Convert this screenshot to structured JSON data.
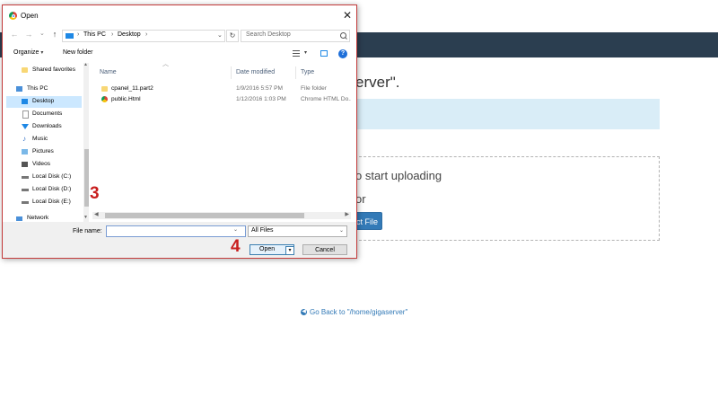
{
  "web_page": {
    "heading_fragment": "erver\".",
    "drop_text": "o start uploading",
    "or_text": "or",
    "select_file_btn": "ct File",
    "go_back_link": "Go Back to \"/home/gigaserver\""
  },
  "dialog": {
    "title": "Open",
    "close_glyph": "✕",
    "nav": {
      "back_glyph": "←",
      "forward_glyph": "→",
      "recent_glyph": "⌄",
      "up_glyph": "↑",
      "breadcrumbs": [
        "This PC",
        "Desktop"
      ],
      "separator": "›",
      "refresh_glyph": "↻",
      "search_placeholder": "Search Desktop"
    },
    "toolbar": {
      "organize_label": "Organize",
      "new_folder_label": "New folder",
      "help_glyph": "?"
    },
    "left_nav": {
      "items": [
        {
          "label": "Shared favorites",
          "icon": "folder-icon"
        },
        {
          "label": "This PC",
          "icon": "pc-icon"
        },
        {
          "label": "Desktop",
          "icon": "desktop-icon",
          "selected": true
        },
        {
          "label": "Documents",
          "icon": "documents-icon"
        },
        {
          "label": "Downloads",
          "icon": "download-icon"
        },
        {
          "label": "Music",
          "icon": "music-icon"
        },
        {
          "label": "Pictures",
          "icon": "pictures-icon"
        },
        {
          "label": "Videos",
          "icon": "videos-icon"
        },
        {
          "label": "Local Disk (C:)",
          "icon": "disk-icon"
        },
        {
          "label": "Local Disk (D:)",
          "icon": "disk-icon"
        },
        {
          "label": "Local Disk (E:)",
          "icon": "disk-icon"
        },
        {
          "label": "Network",
          "icon": "network-icon"
        }
      ]
    },
    "file_list": {
      "columns": [
        "Name",
        "Date modified",
        "Type"
      ],
      "rows": [
        {
          "name": "cpanel_11.part2",
          "date": "1/9/2016 5:57 PM",
          "type": "File folder",
          "icon": "folder-icon"
        },
        {
          "name": "public.Html",
          "date": "1/12/2016 1:03 PM",
          "type": "Chrome HTML Do...",
          "icon": "chrome-icon"
        }
      ]
    },
    "bottom": {
      "file_name_label": "File name:",
      "file_name_value": "",
      "filter_value": "All Files",
      "open_label": "Open",
      "cancel_label": "Cancel"
    }
  },
  "annotations": {
    "step3": "3",
    "step4": "4"
  },
  "colors": {
    "navbar": "#2b3e50",
    "alert": "#d9edf7",
    "link": "#337ab7",
    "annotation": "#c81e1e",
    "selection": "#cce8ff"
  }
}
